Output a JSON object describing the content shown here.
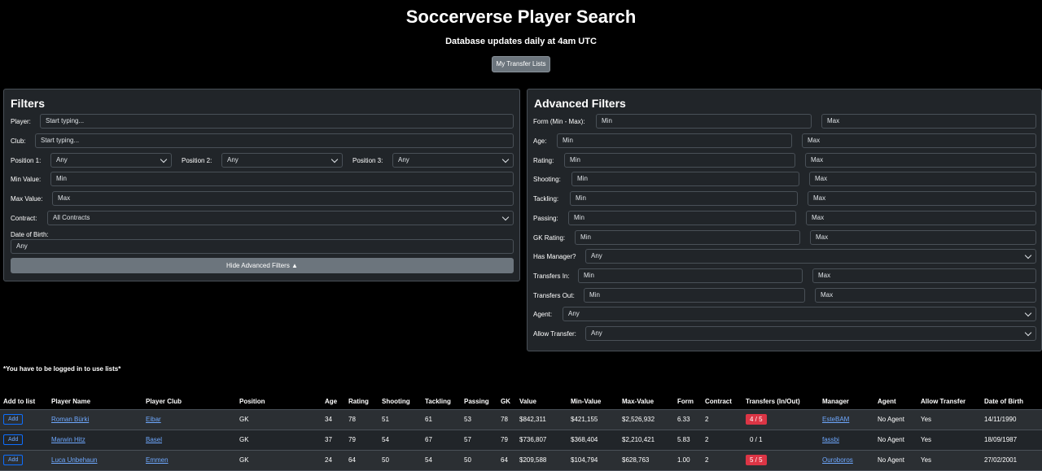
{
  "header": {
    "title": "Soccerverse Player Search",
    "subtitle": "Database updates daily at 4am UTC",
    "lists_button": "My Transfer Lists"
  },
  "filters": {
    "title": "Filters",
    "player_label": "Player:",
    "player_placeholder": "Start typing...",
    "club_label": "Club:",
    "club_placeholder": "Start typing...",
    "pos1_label": "Position 1:",
    "pos1_value": "Any",
    "pos2_label": "Position 2:",
    "pos2_value": "Any",
    "pos3_label": "Position 3:",
    "pos3_value": "Any",
    "min_value_label": "Min Value:",
    "min_value_placeholder": "Min",
    "max_value_label": "Max Value:",
    "max_value_placeholder": "Max",
    "contract_label": "Contract:",
    "contract_value": "All Contracts",
    "dob_label": "Date of Birth:",
    "dob_value": "Any",
    "hide_button": "Hide Advanced Filters ▲"
  },
  "advanced": {
    "title": "Advanced Filters",
    "rows": [
      {
        "label": "Form (Min - Max):",
        "min": "Min",
        "max": "Max"
      },
      {
        "label": "Age:",
        "min": "Min",
        "max": "Max"
      },
      {
        "label": "Rating:",
        "min": "Min",
        "max": "Max"
      },
      {
        "label": "Shooting:",
        "min": "Min",
        "max": "Max"
      },
      {
        "label": "Tackling:",
        "min": "Min",
        "max": "Max"
      },
      {
        "label": "Passing:",
        "min": "Min",
        "max": "Max"
      },
      {
        "label": "GK Rating:",
        "min": "Min",
        "max": "Max"
      }
    ],
    "has_manager_label": "Has Manager?",
    "has_manager_value": "Any",
    "transfers_in_label": "Transfers In:",
    "transfers_in_min": "Min",
    "transfers_in_max": "Max",
    "transfers_out_label": "Transfers Out:",
    "transfers_out_min": "Min",
    "transfers_out_max": "Max",
    "agent_label": "Agent:",
    "agent_value": "Any",
    "allow_transfer_label": "Allow Transfer:",
    "allow_transfer_value": "Any"
  },
  "notice": "*You have to be logged in to use lists*",
  "table": {
    "columns": [
      "Add to list",
      "Player Name",
      "Player Club",
      "Position",
      "Age",
      "Rating",
      "Shooting",
      "Tackling",
      "Passing",
      "GK",
      "Value",
      "Min-Value",
      "Max-Value",
      "Form",
      "Contract",
      "Transfers (In/Out)",
      "Manager",
      "Agent",
      "Allow Transfer",
      "Date of Birth"
    ],
    "add_label": "Add",
    "rows": [
      {
        "name": "Roman Bürki",
        "club": "Eibar",
        "position": "GK",
        "age": "34",
        "rating": "78",
        "shooting": "51",
        "tackling": "61",
        "passing": "53",
        "gk": "78",
        "value": "$842,311",
        "min_value": "$421,155",
        "max_value": "$2,526,932",
        "form": "6.33",
        "contract": "2",
        "transfers": "4 / 5",
        "transfers_flag": "red",
        "manager": "EsteBAM",
        "agent": "No Agent",
        "allow": "Yes",
        "dob": "14/11/1990"
      },
      {
        "name": "Marwin Hitz",
        "club": "Basel",
        "position": "GK",
        "age": "37",
        "rating": "79",
        "shooting": "54",
        "tackling": "67",
        "passing": "57",
        "gk": "79",
        "value": "$736,807",
        "min_value": "$368,404",
        "max_value": "$2,210,421",
        "form": "5.83",
        "contract": "2",
        "transfers": "0 / 1",
        "transfers_flag": "none",
        "manager": "fassbi",
        "agent": "No Agent",
        "allow": "Yes",
        "dob": "18/09/1987"
      },
      {
        "name": "Luca Unbehaun",
        "club": "Emmen",
        "position": "GK",
        "age": "24",
        "rating": "64",
        "shooting": "50",
        "tackling": "54",
        "passing": "50",
        "gk": "64",
        "value": "$209,588",
        "min_value": "$104,794",
        "max_value": "$628,763",
        "form": "1.00",
        "contract": "2",
        "transfers": "5 / 5",
        "transfers_flag": "red",
        "manager": "Ouroboros",
        "agent": "No Agent",
        "allow": "Yes",
        "dob": "27/02/2001"
      }
    ]
  },
  "colors": {
    "background": "#000000",
    "panel": "#212529",
    "border": "#495057",
    "link": "#6ea8fe",
    "secondary": "#6c757d",
    "danger": "#dc3545"
  }
}
